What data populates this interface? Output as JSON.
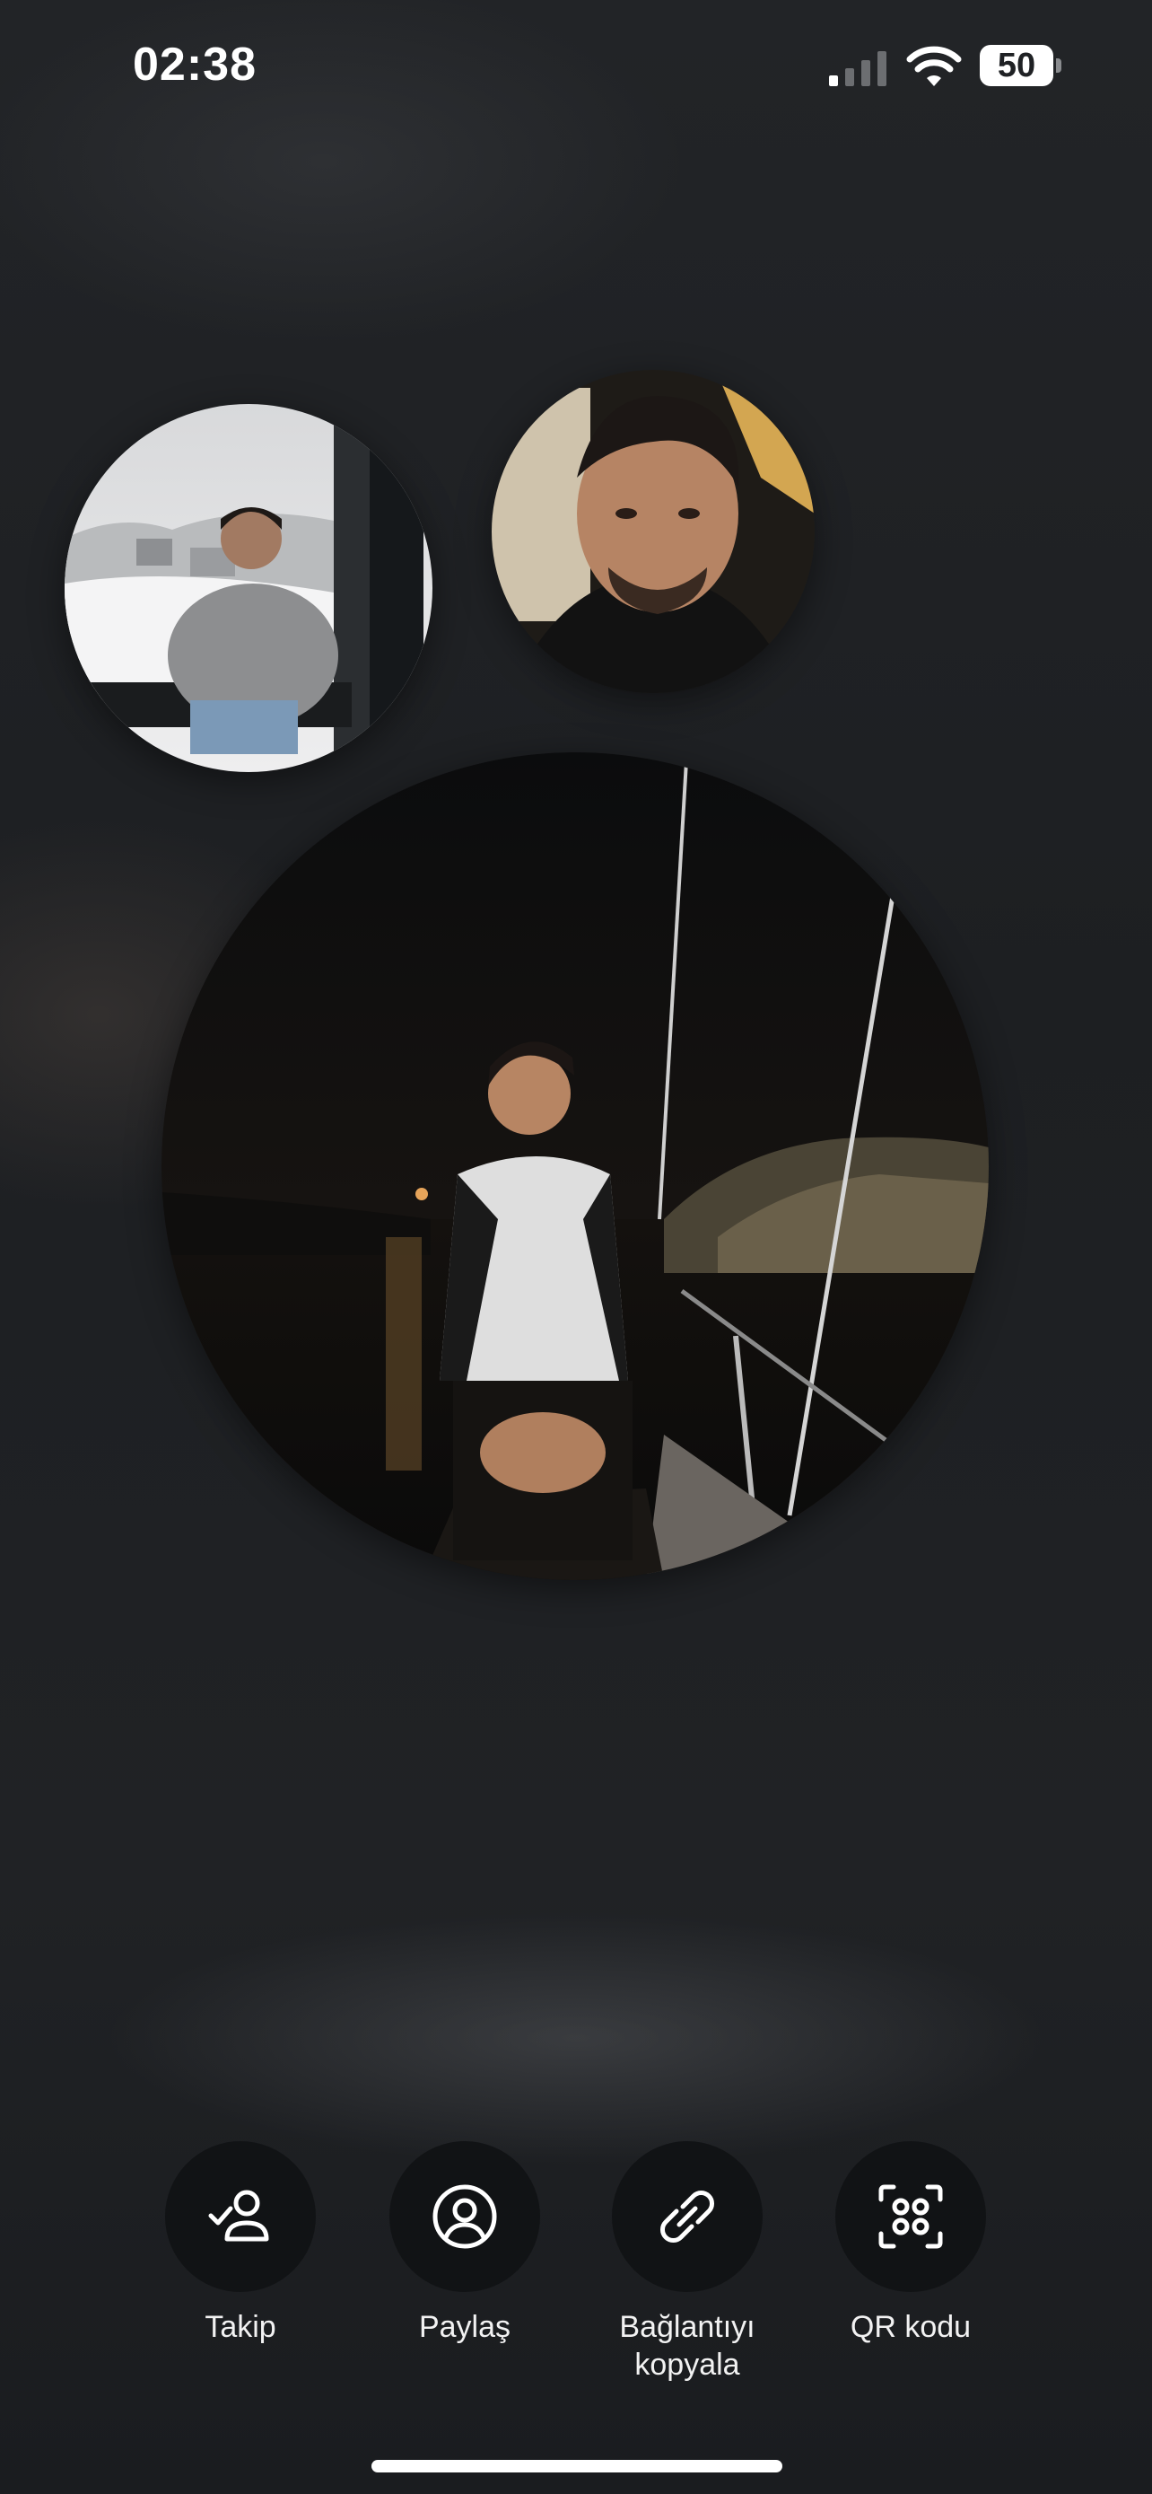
{
  "status_bar": {
    "time": "02:38",
    "battery_level": "50",
    "icons": [
      "signal-icon",
      "wifi-icon",
      "battery-icon"
    ]
  },
  "avatars": [
    {
      "name": "avatar-snowy-window"
    },
    {
      "name": "avatar-selfie"
    },
    {
      "name": "avatar-boat-night"
    }
  ],
  "actions": [
    {
      "label": "Takip",
      "icon": "person-check-icon"
    },
    {
      "label": "Paylaş",
      "icon": "profile-circle-icon"
    },
    {
      "label": "Bağlantıyı\nkopyala",
      "icon": "link-icon"
    },
    {
      "label": "QR kodu",
      "icon": "qr-code-icon"
    }
  ],
  "colors": {
    "background": "#1f2124",
    "button_fill": "#111315",
    "text": "#ffffff"
  }
}
